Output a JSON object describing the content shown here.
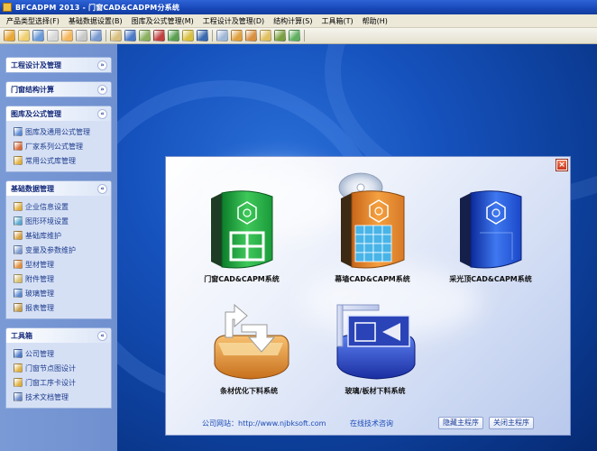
{
  "window": {
    "title": "BFCADPM 2013 - 门窗CAD&CADPM分系统"
  },
  "menu": [
    "产品类型选择(F)",
    "基础数据设置(B)",
    "图库及公式管理(M)",
    "工程设计及管理(D)",
    "结构计算(S)",
    "工具箱(T)",
    "帮助(H)"
  ],
  "toolbar": {
    "colors": [
      "#e8a838",
      "#f0d070",
      "#6a9ad8",
      "#d8d8d8",
      "#f4b860",
      "#c8c8c8",
      "#7a9ad0",
      "#d8c080",
      "#4a7ac8",
      "#8ab060",
      "#c04040",
      "#5aa050",
      "#d8c040",
      "#3a6ab0",
      "#a0b8d8",
      "#e0a040",
      "#d89040",
      "#e0c060",
      "#7aa040",
      "#60b060"
    ],
    "icons": [
      "new-icon",
      "open-icon",
      "folder-icon",
      "save-icon",
      "print-icon",
      "preview-icon",
      "window-icon",
      "list-icon",
      "tree-icon",
      "cad-icon",
      "chart-icon",
      "calc-icon",
      "report-icon",
      "filter-icon",
      "globe-icon",
      "bar-chart-icon",
      "tool-icon",
      "config-icon",
      "check-icon",
      "exit-icon"
    ]
  },
  "sidebar": {
    "panels": [
      {
        "title": "工程设计及管理",
        "chevron": "»",
        "items": []
      },
      {
        "title": "门窗结构计算",
        "chevron": "»",
        "items": []
      },
      {
        "title": "图库及公式管理",
        "chevron": "«",
        "items": [
          {
            "label": "图库及通用公式管理",
            "icon": "library-icon",
            "color": "#5b8ad6"
          },
          {
            "label": "厂家系列公式管理",
            "icon": "series-icon",
            "color": "#d86a3a"
          },
          {
            "label": "常用公式库管理",
            "icon": "formula-icon",
            "color": "#e0b040"
          }
        ]
      },
      {
        "title": "基础数据管理",
        "chevron": "«",
        "items": [
          {
            "label": "企业信息设置",
            "icon": "company-icon",
            "color": "#e0b040"
          },
          {
            "label": "图形环境设置",
            "icon": "graphics-icon",
            "color": "#5aa8d0"
          },
          {
            "label": "基础库维护",
            "icon": "database-icon",
            "color": "#d8a040"
          },
          {
            "label": "变量及参数维护",
            "icon": "variable-icon",
            "color": "#7a9ad0"
          },
          {
            "label": "型材管理",
            "icon": "profile-icon",
            "color": "#e09040"
          },
          {
            "label": "附件管理",
            "icon": "accessory-icon",
            "color": "#d8c070"
          },
          {
            "label": "玻璃管理",
            "icon": "glass-icon",
            "color": "#5a8ad0"
          },
          {
            "label": "报表管理",
            "icon": "report-icon",
            "color": "#c8a050"
          }
        ]
      },
      {
        "title": "工具箱",
        "chevron": "«",
        "items": [
          {
            "label": "公司管理",
            "icon": "company-manage-icon",
            "color": "#4a7ac8"
          },
          {
            "label": "门窗节点图设计",
            "icon": "node-design-icon",
            "color": "#e0b040"
          },
          {
            "label": "门窗工序卡设计",
            "icon": "process-card-icon",
            "color": "#e0b040"
          },
          {
            "label": "技术文档管理",
            "icon": "document-icon",
            "color": "#6a8ac8"
          }
        ]
      }
    ]
  },
  "launcher": {
    "close_glyph": "×",
    "modules": [
      {
        "label": "门窗CAD&CAPM系统",
        "icon": "door-window-system-icon",
        "color": "#28a84a"
      },
      {
        "label": "幕墙CAD&CAPM系统",
        "icon": "curtain-wall-system-icon",
        "color": "#e08a30"
      },
      {
        "label": "采光顶CAD&CAPM系统",
        "icon": "skylight-system-icon",
        "color": "#2a60d8"
      },
      {
        "label": "条材优化下料系统",
        "icon": "bar-optimization-icon",
        "color": "#e09a3a"
      },
      {
        "label": "玻璃/板材下料系统",
        "icon": "glass-cutting-icon",
        "color": "#2a4ac8"
      }
    ],
    "footer": {
      "website": "公司网站：http://www.njbksoft.com",
      "support": "在线技术咨询",
      "hide_button": "隐藏主程序",
      "close_button": "关闭主程序"
    }
  }
}
